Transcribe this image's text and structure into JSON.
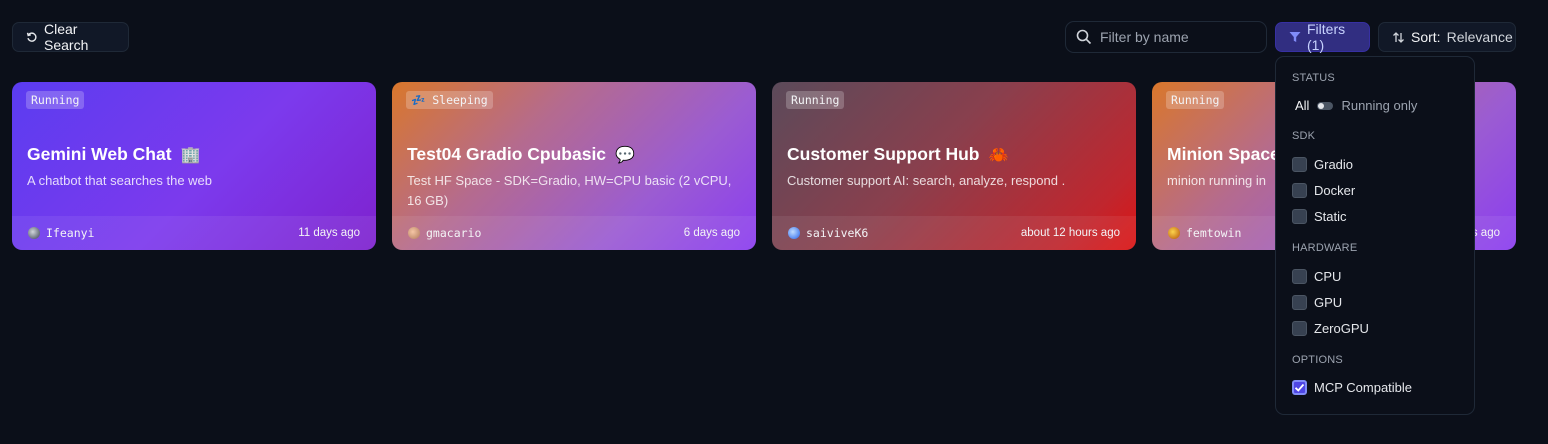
{
  "toolbar": {
    "clear_label": "Clear Search",
    "search_placeholder": "Filter by name",
    "filters_label": "Filters (1)",
    "sort_prefix": "Sort:",
    "sort_value": "Relevance"
  },
  "cards": [
    {
      "status": "Running",
      "title": "Gemini Web Chat",
      "emoji": "🏢",
      "description": "A chatbot that searches the web",
      "user": "Ifeanyi",
      "time": "11 days ago"
    },
    {
      "status": "💤 Sleeping",
      "title": "Test04 Gradio Cpubasic",
      "emoji": "💬",
      "description": "Test HF Space - SDK=Gradio, HW=CPU basic (2 vCPU, 16 GB)",
      "user": "gmacario",
      "time": "6 days ago"
    },
    {
      "status": "Running",
      "title": "Customer Support Hub",
      "emoji": "🦀",
      "description": "Customer support AI: search, analyze, respond .",
      "user": "saiviveK6",
      "time": "about 12 hours ago"
    },
    {
      "status": "Running",
      "title": "Minion Space",
      "emoji": "",
      "description": "minion running in",
      "user": "femtowin",
      "time": "s ago"
    }
  ],
  "filters": {
    "status_heading": "STATUS",
    "status_all": "All",
    "status_running": "Running only",
    "sdk_heading": "SDK",
    "sdk": [
      {
        "label": "Gradio",
        "checked": false
      },
      {
        "label": "Docker",
        "checked": false
      },
      {
        "label": "Static",
        "checked": false
      }
    ],
    "hardware_heading": "HARDWARE",
    "hardware": [
      {
        "label": "CPU",
        "checked": false
      },
      {
        "label": "GPU",
        "checked": false
      },
      {
        "label": "ZeroGPU",
        "checked": false
      }
    ],
    "options_heading": "OPTIONS",
    "options": [
      {
        "label": "MCP Compatible",
        "checked": true
      }
    ]
  },
  "colors": {
    "background": "#0b0f19",
    "accent": "#4f46e5"
  }
}
